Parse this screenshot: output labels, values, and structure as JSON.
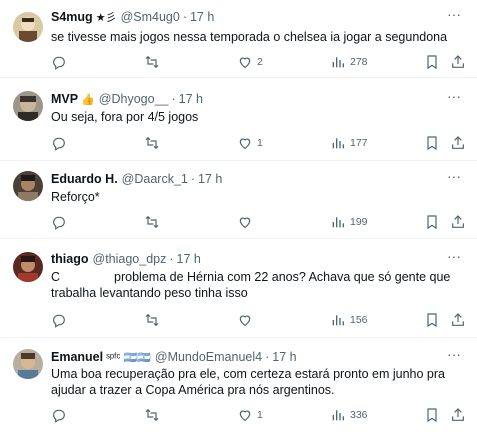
{
  "tweets": [
    {
      "name": "S4mug",
      "name_badge": "★彡",
      "handle": "@Sm4ug0",
      "dot": "·",
      "time": "17 h",
      "text": "se tivesse mais jogos nessa temporada o chelsea ia jogar a segundona",
      "likes": "2",
      "views": "278",
      "avatar_color": "#c9b48a"
    },
    {
      "name": "MVP",
      "name_badge": "👍",
      "handle": "@Dhyogo__",
      "dot": "·",
      "time": "17 h",
      "text": "Ou seja, fora por 4/5 jogos",
      "likes": "1",
      "views": "177",
      "avatar_color": "#8b8378"
    },
    {
      "name": "Eduardo H.",
      "name_badge": "",
      "handle": "@Daarck_1",
      "dot": "·",
      "time": "17 h",
      "text": "Reforço*",
      "likes": "",
      "views": "199",
      "avatar_color": "#6b5a48"
    },
    {
      "name": "thiago",
      "name_badge": "",
      "handle": "@thiago_dpz",
      "dot": "·",
      "time": "17 h",
      "text_start": "C",
      "text": "problema de Hérnia com 22 anos? Achava que só gente que",
      "text_line2": "trabalha levantando peso tinha isso",
      "likes": "",
      "views": "156",
      "avatar_color": "#7a3b2e"
    },
    {
      "name": "Emanuel",
      "name_badge": "ˢᵖᶠᶜ 🇦🇷🇦🇷",
      "handle": "@MundoEmanuel4",
      "dot": "·",
      "time": "17 h",
      "text": "Uma boa recuperação pra ele, com certeza estará pronto em junho pra",
      "text_line2": "ajudar a trazer a Copa América pra nós argentinos.",
      "likes": "1",
      "views": "336",
      "avatar_color": "#9a8e7c"
    }
  ],
  "more_label": "···"
}
